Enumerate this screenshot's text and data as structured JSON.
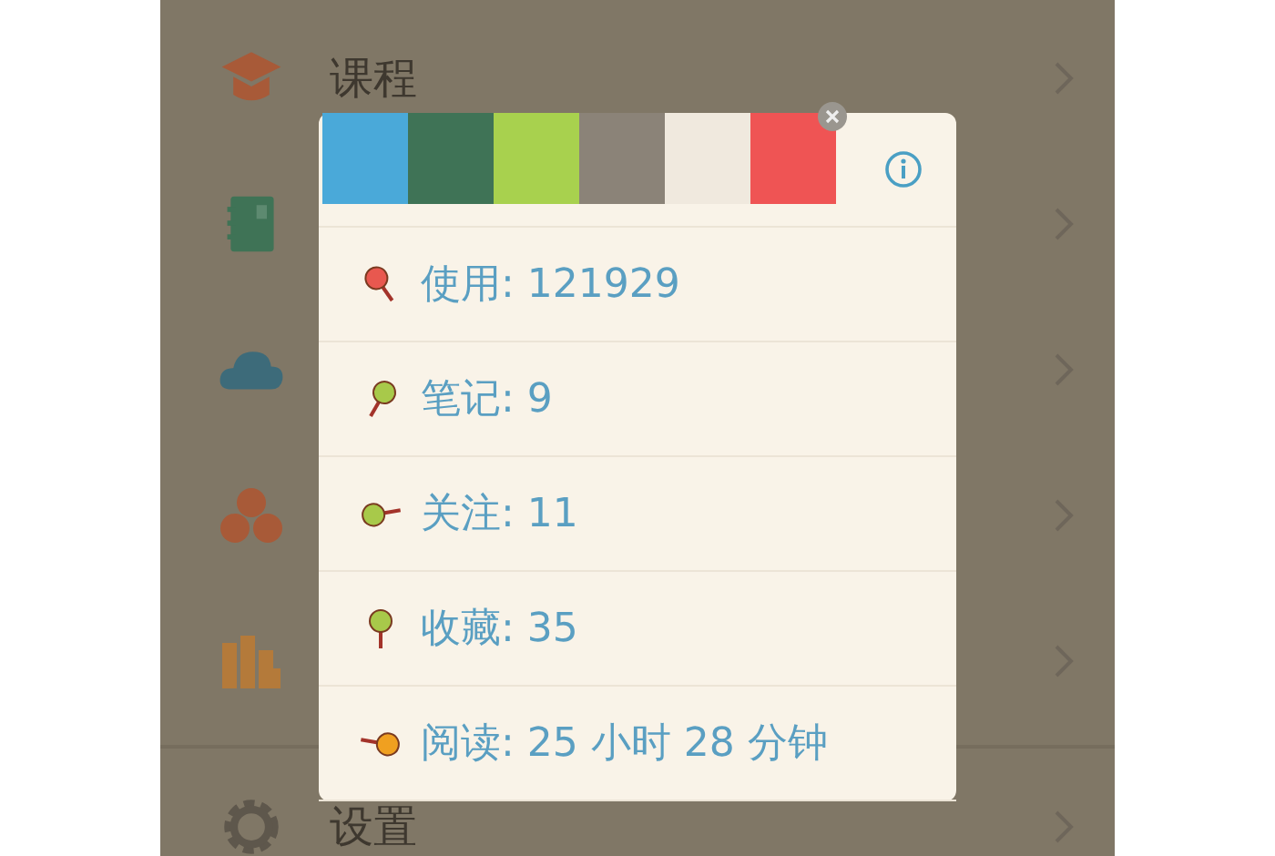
{
  "menu": {
    "top_label": "课程",
    "bottom_label": "设置"
  },
  "popup": {
    "swatches": [
      {
        "color": "#4aa9d9"
      },
      {
        "color": "#3f7356"
      },
      {
        "color": "#a8d14e"
      },
      {
        "color": "#8b8378"
      },
      {
        "color": "#f0e9de"
      },
      {
        "color": "#ef5454"
      }
    ],
    "stats": [
      {
        "text": "使用: 121929",
        "color": "#e8584f"
      },
      {
        "text": "笔记: 9",
        "color": "#a8c94a"
      },
      {
        "text": "关注: 11",
        "color": "#a8c94a"
      },
      {
        "text": "收藏: 35",
        "color": "#a8c94a"
      },
      {
        "text": "阅读: 25 小时 28 分钟",
        "color": "#f0a020"
      }
    ]
  }
}
